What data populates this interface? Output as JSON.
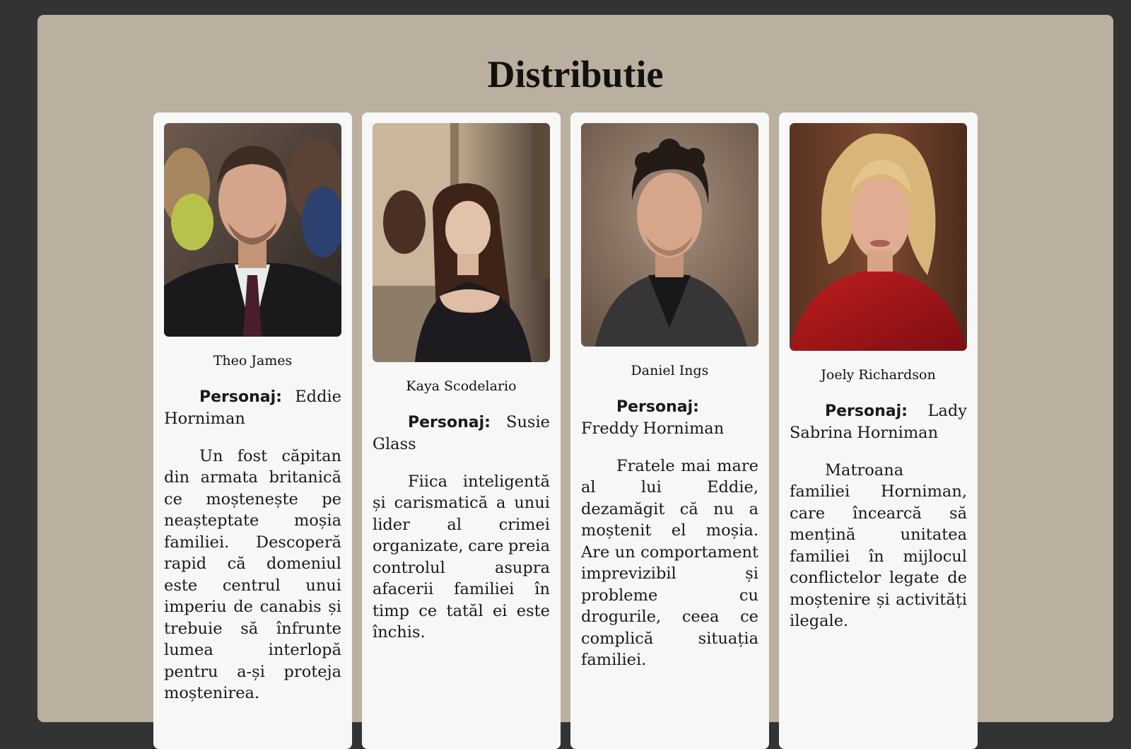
{
  "page": {
    "title": "Distributie"
  },
  "cast": [
    {
      "name": "Theo James",
      "role_label": "Personaj:",
      "role": "Eddie Horniman",
      "description": "Un fost căpitan din armata britanică ce moștenește pe neașteptate moșia familiei. Descoperă rapid că domeniul este centrul unui imperiu de canabis și trebuie să înfrunte lumea interlopă pentru a-și proteja moștenirea."
    },
    {
      "name": "Kaya Scodelario",
      "role_label": "Personaj:",
      "role": "Susie Glass",
      "description": "Fiica inteligentă și carismatică a unui lider al crimei organizate, care preia controlul asupra afacerii familiei în timp ce tatăl ei este închis."
    },
    {
      "name": "Daniel Ings",
      "role_label": "Personaj:",
      "role": "Freddy Horniman",
      "description": "Fratele mai mare al lui Eddie, dezamăgit că nu a moștenit el moșia. Are un comportament imprevizibil și probleme cu drogurile, ceea ce complică situația familiei."
    },
    {
      "name": "Joely Richardson",
      "role_label": "Personaj:",
      "role": "Lady Sabrina Horniman",
      "description": "Matroana familiei Horniman, care încearcă să mențină unitatea familiei în mijlocul conflictelor legate de moștenire și activități ilegale."
    }
  ],
  "colors": {
    "page_background": "#333333",
    "panel_background": "#bbaf9f",
    "card_background": "#f7f7f7",
    "text": "#1a1a1a"
  }
}
